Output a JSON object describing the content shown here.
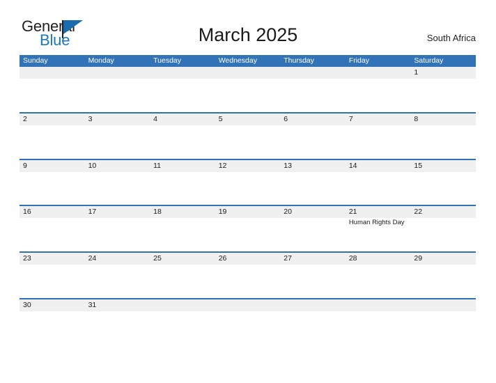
{
  "brand": {
    "name_part1": "General",
    "name_part2": "Blue"
  },
  "header": {
    "title": "March 2025",
    "region": "South Africa"
  },
  "colors": {
    "header_blue": "#3272b6",
    "row_divider_blue": "#2e72b3",
    "row_band_gray": "#f0f0f0",
    "brand_blue": "#1878be",
    "text_dark": "#1a1a1a"
  },
  "calendar": {
    "weekdays": [
      "Sunday",
      "Monday",
      "Tuesday",
      "Wednesday",
      "Thursday",
      "Friday",
      "Saturday"
    ],
    "weeks": [
      [
        {
          "date": ""
        },
        {
          "date": ""
        },
        {
          "date": ""
        },
        {
          "date": ""
        },
        {
          "date": ""
        },
        {
          "date": ""
        },
        {
          "date": "1"
        }
      ],
      [
        {
          "date": "2"
        },
        {
          "date": "3"
        },
        {
          "date": "4"
        },
        {
          "date": "5"
        },
        {
          "date": "6"
        },
        {
          "date": "7"
        },
        {
          "date": "8"
        }
      ],
      [
        {
          "date": "9"
        },
        {
          "date": "10"
        },
        {
          "date": "11"
        },
        {
          "date": "12"
        },
        {
          "date": "13"
        },
        {
          "date": "14"
        },
        {
          "date": "15"
        }
      ],
      [
        {
          "date": "16"
        },
        {
          "date": "17"
        },
        {
          "date": "18"
        },
        {
          "date": "19"
        },
        {
          "date": "20"
        },
        {
          "date": "21",
          "event": "Human Rights Day"
        },
        {
          "date": "22"
        }
      ],
      [
        {
          "date": "23"
        },
        {
          "date": "24"
        },
        {
          "date": "25"
        },
        {
          "date": "26"
        },
        {
          "date": "27"
        },
        {
          "date": "28"
        },
        {
          "date": "29"
        }
      ],
      [
        {
          "date": "30"
        },
        {
          "date": "31"
        },
        {
          "date": ""
        },
        {
          "date": ""
        },
        {
          "date": ""
        },
        {
          "date": ""
        },
        {
          "date": ""
        }
      ]
    ]
  }
}
